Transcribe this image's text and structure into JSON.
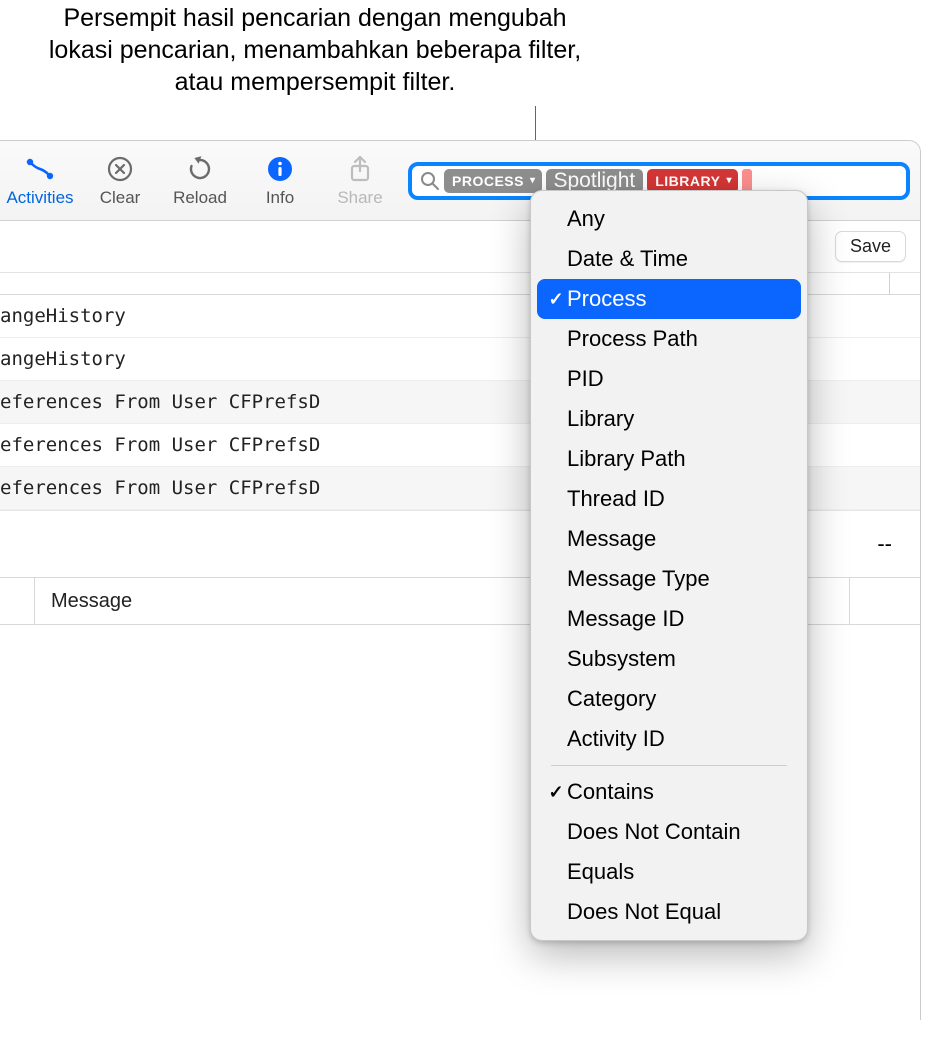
{
  "callout": {
    "text": "Persempit hasil pencarian dengan mengubah lokasi pencarian, menambahkan beberapa filter, atau mempersempit filter."
  },
  "toolbar": {
    "activities": "Activities",
    "clear": "Clear",
    "reload": "Reload",
    "info": "Info",
    "share": "Share"
  },
  "search": {
    "token_process": "PROCESS",
    "token_process_value": "Spotlight",
    "token_library": "LIBRARY"
  },
  "save_label": "Save",
  "rows": [
    "angeHistory",
    "angeHistory",
    "eferences From User CFPrefsD",
    "eferences From User CFPrefsD",
    "eferences From User CFPrefsD"
  ],
  "dash": "--",
  "column_header": "Message",
  "menu": {
    "group1": [
      {
        "label": "Any",
        "checked": false,
        "selected": false
      },
      {
        "label": "Date & Time",
        "checked": false,
        "selected": false
      },
      {
        "label": "Process",
        "checked": true,
        "selected": true
      },
      {
        "label": "Process Path",
        "checked": false,
        "selected": false
      },
      {
        "label": "PID",
        "checked": false,
        "selected": false
      },
      {
        "label": "Library",
        "checked": false,
        "selected": false
      },
      {
        "label": "Library Path",
        "checked": false,
        "selected": false
      },
      {
        "label": "Thread ID",
        "checked": false,
        "selected": false
      },
      {
        "label": "Message",
        "checked": false,
        "selected": false
      },
      {
        "label": "Message Type",
        "checked": false,
        "selected": false
      },
      {
        "label": "Message ID",
        "checked": false,
        "selected": false
      },
      {
        "label": "Subsystem",
        "checked": false,
        "selected": false
      },
      {
        "label": "Category",
        "checked": false,
        "selected": false
      },
      {
        "label": "Activity ID",
        "checked": false,
        "selected": false
      }
    ],
    "group2": [
      {
        "label": "Contains",
        "checked": true,
        "selected": false
      },
      {
        "label": "Does Not Contain",
        "checked": false,
        "selected": false
      },
      {
        "label": "Equals",
        "checked": false,
        "selected": false
      },
      {
        "label": "Does Not Equal",
        "checked": false,
        "selected": false
      }
    ]
  }
}
